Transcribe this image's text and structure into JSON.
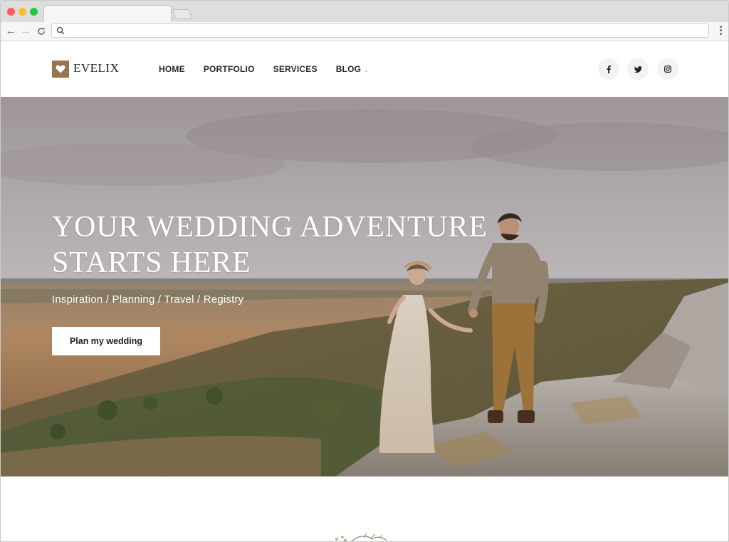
{
  "browser": {
    "address_value": "",
    "icons": {
      "back": "arrow-left-icon",
      "forward": "arrow-right-icon",
      "reload": "reload-icon",
      "search": "search-icon",
      "menu": "kebab-menu-icon"
    }
  },
  "site": {
    "brand": "EVELIX",
    "logo_icon": "heart-icon",
    "accent_color": "#9a7350",
    "nav": [
      {
        "label": "HOME"
      },
      {
        "label": "PORTFOLIO"
      },
      {
        "label": "SERVICES"
      },
      {
        "label": "BLOG",
        "has_dropdown": true
      }
    ],
    "social": [
      "facebook-icon",
      "twitter-icon",
      "instagram-icon"
    ]
  },
  "hero": {
    "title_line1": "YOUR WEDDING ADVENTURE",
    "title_line2": "STARTS HERE",
    "subtitle": "Inspiration / Planning / Travel / Registry",
    "cta_label": "Plan my wedding",
    "image": "couple-on-rocky-hilltop"
  }
}
